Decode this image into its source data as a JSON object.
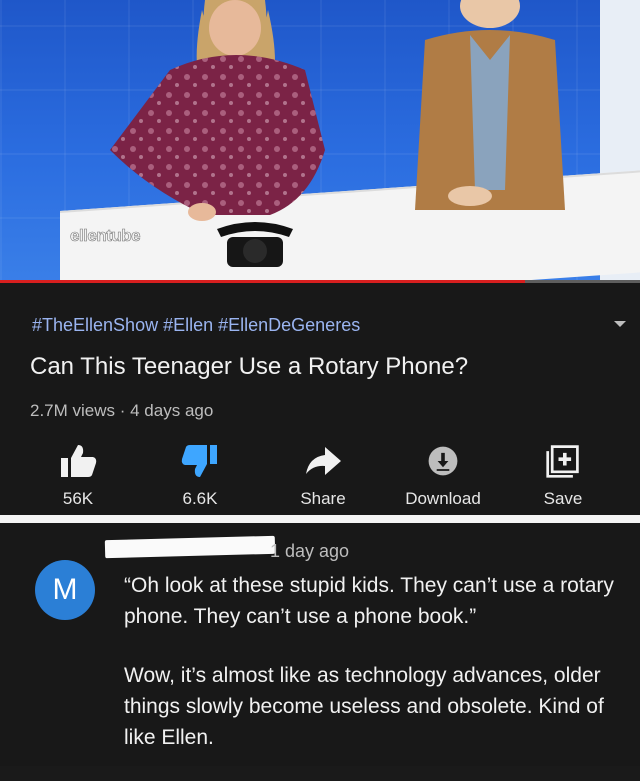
{
  "video": {
    "watermark": "ellentube",
    "progress_fraction": 0.82
  },
  "info": {
    "hashtags": "#TheEllenShow #Ellen #EllenDeGeneres",
    "title": "Can This Teenager Use a Rotary Phone?",
    "meta": "2.7M views · 4 days ago"
  },
  "actions": [
    {
      "icon": "thumbs-up-icon",
      "label": "56K"
    },
    {
      "icon": "thumbs-down-icon",
      "label": "6.6K",
      "color": "#3ea6ff"
    },
    {
      "icon": "share-arrow-icon",
      "label": "Share"
    },
    {
      "icon": "download-icon",
      "label": "Download"
    },
    {
      "icon": "add-to-playlist-icon",
      "label": "Save"
    }
  ],
  "comment": {
    "avatar_letter": "M",
    "avatar_color": "#2b7fd6",
    "time": "1 day ago",
    "paragraph1": "“Oh look at these stupid kids. They can’t use a rotary phone. They can’t use a phone book.”",
    "paragraph2": "Wow, it’s almost like as technology advances, older things slowly become useless and obsolete. Kind of like Ellen."
  }
}
